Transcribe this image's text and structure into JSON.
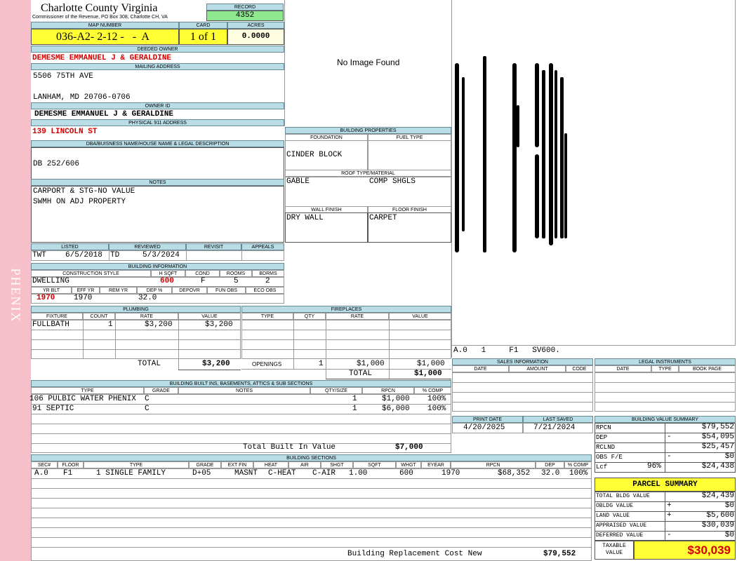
{
  "sidebar": {
    "label": "PHENIX"
  },
  "header": {
    "county": "Charlotte County Virginia",
    "commissioner": "Commissioner of the Revenue, PO Box 308, Charlotte CH, VA",
    "record_label": "RECORD",
    "record_value": "4352",
    "map_label": "MAP NUMBER",
    "map_value": "036-A2- 2-12 -   -  A",
    "card_label": "CARD",
    "card_value": "1 of 1",
    "acres_label": "ACRES",
    "acres_value": "0.0000"
  },
  "owner": {
    "deeded_label": "DEEDED OWNER",
    "deeded_value": "DEMESME EMMANUEL J & GERALDINE",
    "mailing_label": "MAILING ADDRESS",
    "mailing_line1": "5506 75TH AVE",
    "mailing_line2": "LANHAM, MD 20706-0706",
    "ownerid_label": "OWNER ID",
    "ownerid_value": "DEMESME EMMANUEL J & GERALDINE",
    "physical_label": "PHYSICAL 911 ADDRESS",
    "physical_value": "139 LINCOLN ST"
  },
  "legal": {
    "label": "DBA/BUISNESS NAME/HOUSE NAME & LEGAL DESCRIPTION",
    "value": "DB 252/606"
  },
  "notes": {
    "label": "NOTES",
    "line1": "CARPORT & STG-NO VALUE",
    "line2": "SWMH ON ADJ PROPERTY"
  },
  "image": {
    "text": "No Image Found"
  },
  "sketch": {
    "caption": "A.0   1     F1   SV600."
  },
  "building_properties": {
    "label": "BUILDING PROPERTIES",
    "foundation_label": "FOUNDATION",
    "foundation_value": "CINDER BLOCK",
    "fuel_label": "FUEL TYPE",
    "fuel_value": "",
    "roof_label": "ROOF TYPE/MATERIAL",
    "roof_type": "GABLE",
    "roof_material": "COMP SHGLS",
    "wall_label": "WALL FINISH",
    "wall_value": "DRY WALL",
    "floor_label": "FLOOR FINISH",
    "floor_value": "CARPET"
  },
  "listing": {
    "listed_label": "LISTED",
    "listed_by": "TWT",
    "listed_date": "6/5/2018",
    "reviewed_label": "REVIEWED",
    "reviewed_by": "TD",
    "reviewed_date": "5/3/2024",
    "revisit_label": "REVISIT",
    "appeals_label": "APPEALS"
  },
  "building_info": {
    "label": "BUILDING INFORMATION",
    "style_label": "CONSTRUCTION STYLE",
    "style_value": "DWELLING",
    "hsqft_label": "H SQFT",
    "hsqft_value": "600",
    "cond_label": "COND",
    "cond_value": "F",
    "rooms_label": "ROOMS",
    "rooms_value": "5",
    "bdrms_label": "BDRMS",
    "bdrms_value": "2",
    "yrblt_label": "YR BLT",
    "yrblt_value": "1970",
    "effyr_label": "EFF YR",
    "effyr_value": "1970",
    "remyr_label": "REM YR",
    "deppct_label": "DEP %",
    "deppct_value": "32.0",
    "depovr_label": "DEPOVR",
    "funobs_label": "FUN OBS",
    "ecoobs_label": "ECO OBS"
  },
  "plumbing": {
    "label": "PLUMBING",
    "col_fixture": "FIXTURE",
    "col_count": "COUNT",
    "col_rate": "RATE",
    "col_value": "VALUE",
    "fixture": "FULLBATH",
    "count": "1",
    "rate": "$3,200",
    "value": "$3,200",
    "total_label": "TOTAL",
    "total_value": "$3,200"
  },
  "fireplaces": {
    "label": "FIREPLACES",
    "col_type": "TYPE",
    "col_qty": "QTY",
    "col_rate": "RATE",
    "col_value": "VALUE",
    "openings_label": "OPENINGS",
    "openings_qty": "1",
    "openings_rate": "$1,000",
    "openings_value": "$1,000",
    "total_label": "TOTAL",
    "total_value": "$1,000"
  },
  "builtins": {
    "label": "BUILDING BUILT INS, BASEMENTS, ATTICS & SUB SECTIONS",
    "col_type": "TYPE",
    "col_grade": "GRADE",
    "col_notes": "NOTES",
    "col_qty": "QTY/SIZE",
    "col_rpcn": "RPCN",
    "col_comp": "% COMP",
    "rows": [
      {
        "type": "106 PULBIC WATER PHENIX",
        "grade": "C",
        "qty": "1",
        "rpcn": "$1,000",
        "comp": "100%"
      },
      {
        "type": "91 SEPTIC",
        "grade": "C",
        "qty": "1",
        "rpcn": "$6,000",
        "comp": "100%"
      }
    ],
    "total_label": "Total Built In Value",
    "total_value": "$7,000"
  },
  "sales": {
    "label": "SALES INFORMATION",
    "col_date": "DATE",
    "col_amount": "AMOUNT",
    "col_code": "CODE"
  },
  "legal_instruments": {
    "label": "LEGAL INSTRUMENTS",
    "col_date": "DATE",
    "col_type": "TYPE",
    "col_book": "BOOK PAGE"
  },
  "print": {
    "print_label": "PRINT DATE",
    "print_value": "4/20/2025",
    "saved_label": "LAST SAVED",
    "saved_value": "7/21/2024"
  },
  "value_summary": {
    "label": "BUILDING VALUE SUMMARY",
    "rpcn_label": "RPCN",
    "rpcn_value": "$79,552",
    "dep_label": "DEP",
    "dep_sign": "-",
    "dep_value": "$54,095",
    "rclnd_label": "RCLND",
    "rclnd_value": "$25,457",
    "obs_label": "OBS F/E",
    "obs_sign": "-",
    "obs_value": "$0",
    "lcf_label": "Lcf",
    "lcf_pct": "96%",
    "lcf_value": "$24,438"
  },
  "parcel_summary": {
    "label": "PARCEL SUMMARY",
    "total_bldg_label": "TOTAL BLDG VALUE",
    "total_bldg_value": "$24,439",
    "obldg_label": "OBLDG VALUE",
    "obldg_sign": "+",
    "obldg_value": "$0",
    "land_label": "LAND VALUE",
    "land_sign": "+",
    "land_value": "$5,600",
    "appraised_label": "APPRAISED VALUE",
    "appraised_value": "$30,039",
    "deferred_label": "DEFERRED VALUE",
    "deferred_sign": "-",
    "deferred_value": "$0",
    "taxable_label": "TAXABLE VALUE",
    "taxable_value": "$30,039"
  },
  "sections": {
    "label": "BUILDING SECTIONS",
    "columns": [
      "SEC#",
      "FLOOR",
      "TYPE",
      "GRADE",
      "EXT FIN",
      "HEAT",
      "AIR",
      "SHGT",
      "SQFT",
      "WHGT",
      "EYEAR",
      "RPCN",
      "DEP",
      "% COMP"
    ],
    "row": {
      "sec": "A.0",
      "floor": "F1",
      "type": "1 SINGLE FAMILY",
      "grade": "D+05",
      "extfin": "MASNT",
      "heat": "C-HEAT",
      "air": "C-AIR",
      "shgt": "1.00",
      "sqft": "600",
      "whgt": "",
      "eyear": "1970",
      "rpcn": "$68,352",
      "dep": "32.0",
      "comp": "100%"
    },
    "total_label": "Building Replacement Cost New",
    "total_value": "$79,552"
  },
  "colors": {
    "sidebar": "#f7bfc9",
    "header_bg": "#b8dde6",
    "yellow": "#ffff33",
    "green": "#8ee88e",
    "red": "#d40000"
  }
}
